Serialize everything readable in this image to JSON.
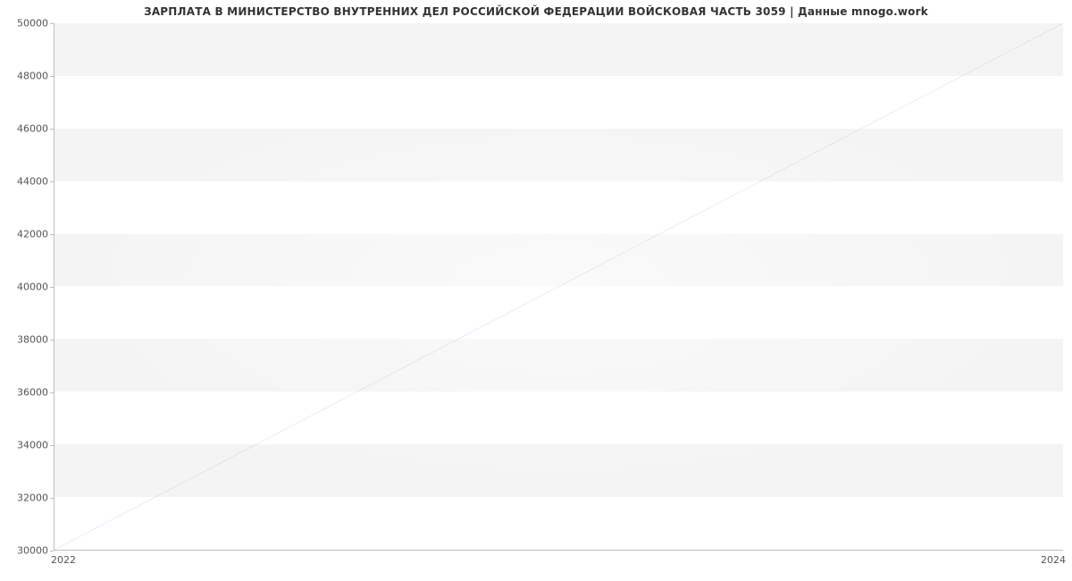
{
  "chart_data": {
    "type": "line",
    "title": "ЗАРПЛАТА В МИНИСТЕРСТВО ВНУТРЕННИХ ДЕЛ РОССИЙСКОЙ ФЕДЕРАЦИИ ВОЙСКОВАЯ ЧАСТЬ 3059 | Данные mnogo.work",
    "x": [
      2022,
      2024
    ],
    "values": [
      30000,
      50000
    ],
    "xlabel": "",
    "ylabel": "",
    "x_ticks": [
      2022,
      2024
    ],
    "y_ticks": [
      30000,
      32000,
      34000,
      36000,
      38000,
      40000,
      42000,
      44000,
      46000,
      48000,
      50000
    ],
    "ylim": [
      30000,
      50000
    ],
    "xlim": [
      2022,
      2024
    ],
    "line_color": "#6f94d8"
  }
}
